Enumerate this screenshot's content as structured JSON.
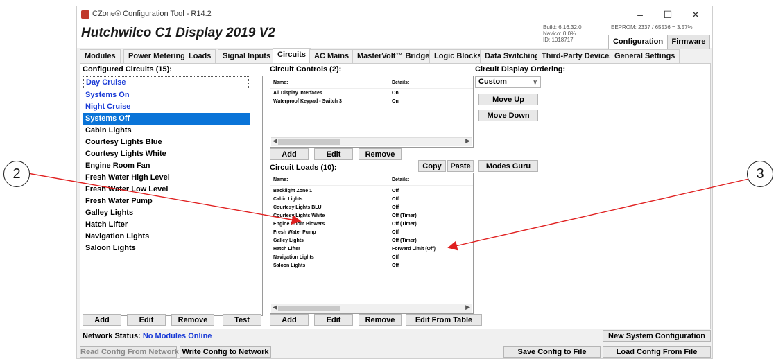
{
  "window": {
    "title": "CZone® Configuration Tool - R14.2",
    "app_title": "Hutchwilco C1 Display 2019 V2",
    "build_lines": [
      "Build: 6.16.32.0",
      "Navico: 0.0%",
      "ID: 1018717"
    ],
    "eeprom": "EEPROM: 2337 / 65536 = 3.57%",
    "mode_tabs": [
      "Configuration",
      "Firmware"
    ]
  },
  "tabs": [
    "Modules",
    "Power Metering",
    "Loads",
    "Signal Inputs",
    "Circuits",
    "AC Mains",
    "MasterVolt™ Bridge",
    "Logic Blocks",
    "Data Switching",
    "Third-Party Devices",
    "General Settings"
  ],
  "active_tab": "Circuits",
  "configured": {
    "label": "Configured Circuits (15):",
    "items": [
      "Day Cruise",
      "Systems On",
      "Night Cruise",
      "Systems Off",
      "Cabin Lights",
      "Courtesy Lights Blue",
      "Courtesy Lights White",
      "Engine Room Fan",
      "Fresh Water High Level",
      "Fresh Water Low Level",
      "Fresh Water Pump",
      "Galley Lights",
      "Hatch Lifter",
      "Navigation Lights",
      "Saloon Lights"
    ],
    "selected": "Systems Off",
    "buttons": [
      "Add",
      "Edit",
      "Remove",
      "Test"
    ]
  },
  "controls": {
    "label": "Circuit Controls (2):",
    "headers": [
      "Name:",
      "Details:"
    ],
    "rows": [
      [
        "All Display Interfaces",
        "On"
      ],
      [
        "Waterproof Keypad - Switch 3",
        "On"
      ]
    ],
    "buttons": [
      "Add",
      "Edit",
      "Remove"
    ]
  },
  "loads": {
    "label": "Circuit Loads (10):",
    "headers": [
      "Name:",
      "Details:"
    ],
    "rows": [
      [
        "Backlight Zone 1",
        "Off"
      ],
      [
        "Cabin Lights",
        "Off"
      ],
      [
        "Courtesy Lights BLU",
        "Off"
      ],
      [
        "Courtesy Lights White",
        "Off (Timer)"
      ],
      [
        "Engine Room Blowers",
        "Off (Timer)"
      ],
      [
        "Fresh Water Pump",
        "Off"
      ],
      [
        "Galley Lights",
        "Off (Timer)"
      ],
      [
        "Hatch Lifter",
        "Forward Limit (Off)"
      ],
      [
        "Navigation Lights",
        "Off"
      ],
      [
        "Saloon Lights",
        "Off"
      ]
    ],
    "copy": "Copy",
    "paste": "Paste",
    "buttons": [
      "Add",
      "Edit",
      "Remove",
      "Edit From Table"
    ]
  },
  "ordering": {
    "label": "Circuit Display Ordering:",
    "value": "Custom",
    "move_up": "Move Up",
    "move_down": "Move Down",
    "modes_guru": "Modes Guru"
  },
  "status": {
    "label": "Network Status:",
    "value": "No Modules Online"
  },
  "bottom": {
    "new_system": "New System Configuration",
    "read": "Read Config From Network",
    "write": "Write Config to Network",
    "save": "Save Config to File",
    "load": "Load Config From File"
  },
  "callouts": [
    "2",
    "3"
  ],
  "colors": {
    "accent_blue": "#1a3bd6",
    "selection": "#0a74d8",
    "arrow": "#e02020"
  }
}
